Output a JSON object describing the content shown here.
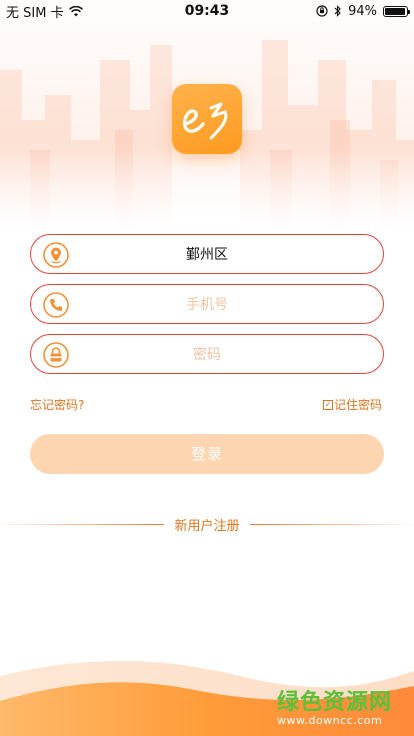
{
  "status_bar": {
    "carrier": "无 SIM 卡",
    "time": "09:43",
    "battery_percent_text": "94%",
    "battery_level": 0.94
  },
  "logo": {
    "text": "e乡",
    "color": "#ff9a1f"
  },
  "form": {
    "region_value": "鄞州区",
    "phone_placeholder": "手机号",
    "password_placeholder": "密码",
    "forgot_label": "忘记密码?",
    "remember_label": "记住密码",
    "remember_checked": true,
    "login_label": "登录",
    "register_label": "新用户注册"
  },
  "watermark": {
    "title": "绿色资源网",
    "url": "www.downcc.com"
  },
  "colors": {
    "accent": "#e8433a",
    "orange": "#e0731e",
    "button_bg": "#fdd5b0"
  }
}
